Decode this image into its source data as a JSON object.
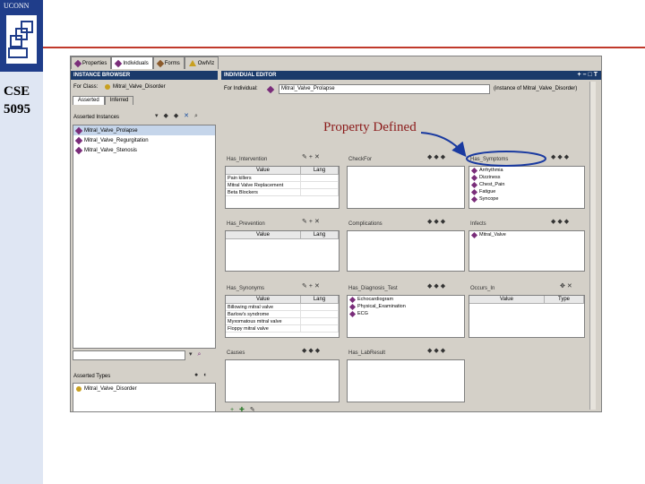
{
  "slide": {
    "logo_text": "UCONN",
    "course_line1": "CSE",
    "course_line2": "5095",
    "annotation": "Property Defined",
    "accent_color": "#c0392b"
  },
  "app": {
    "tabs": [
      {
        "label": "Properties",
        "icon": "slots-icon"
      },
      {
        "label": "Individuals",
        "icon": "individual-icon"
      },
      {
        "label": "Forms",
        "icon": "forms-icon"
      },
      {
        "label": "OwlViz",
        "icon": "owlviz-icon"
      }
    ],
    "instance_browser": {
      "title": "INSTANCE BROWSER",
      "for_class_label": "For Class:",
      "for_class_value": "Mitral_Valve_Disorder",
      "subtabs": [
        "Asserted",
        "Inferred"
      ],
      "asserted_instances_label": "Asserted Instances",
      "instances": [
        "Mitral_Valve_Prolapse",
        "Mitral_Valve_Regurgitation",
        "Mitral_Valve_Stenosis"
      ],
      "asserted_types_label": "Asserted Types",
      "types": [
        "Mitral_Valve_Disorder"
      ]
    },
    "editor": {
      "title": "INDIVIDUAL EDITOR",
      "for_individual_label": "For Individual:",
      "for_individual_value": "Mitral_Valve_Prolapse",
      "instance_of": "(instance of Mitral_Valve_Disorder)",
      "slots": {
        "intervention": {
          "title": "Has_Intervention",
          "cols": [
            "Value",
            "Lang"
          ],
          "rows": [
            "Pain killers",
            "Mitral Valve Replacement",
            "Beta Blockers"
          ]
        },
        "checkfor": {
          "title": "CheckFor"
        },
        "symptoms": {
          "title": "Has_Symptoms",
          "items": [
            "Arrhythmia",
            "Dizziness",
            "Chest_Pain",
            "Fatigue",
            "Syncope"
          ]
        },
        "prevention": {
          "title": "Has_Prevention",
          "cols": [
            "Value",
            "Lang"
          ]
        },
        "complications": {
          "title": "Complications"
        },
        "infects": {
          "title": "Infects",
          "items": [
            "Mitral_Valve"
          ]
        },
        "synonyms": {
          "title": "Has_Synonyms",
          "cols": [
            "Value",
            "Lang"
          ],
          "rows": [
            "Billowing mitral valve",
            "Barlow's syndrome",
            "Myxomatous mitral valve",
            "Floppy mitral valve"
          ]
        },
        "diagnosis": {
          "title": "Has_Diagnosis_Test",
          "items": [
            "Echocardiogram",
            "Physical_Examination",
            "ECG"
          ]
        },
        "occurs": {
          "title": "Occurs_In",
          "cols": [
            "Value",
            "Type"
          ]
        },
        "causes": {
          "title": "Causes"
        },
        "labresult": {
          "title": "Has_LabResult"
        }
      }
    }
  }
}
